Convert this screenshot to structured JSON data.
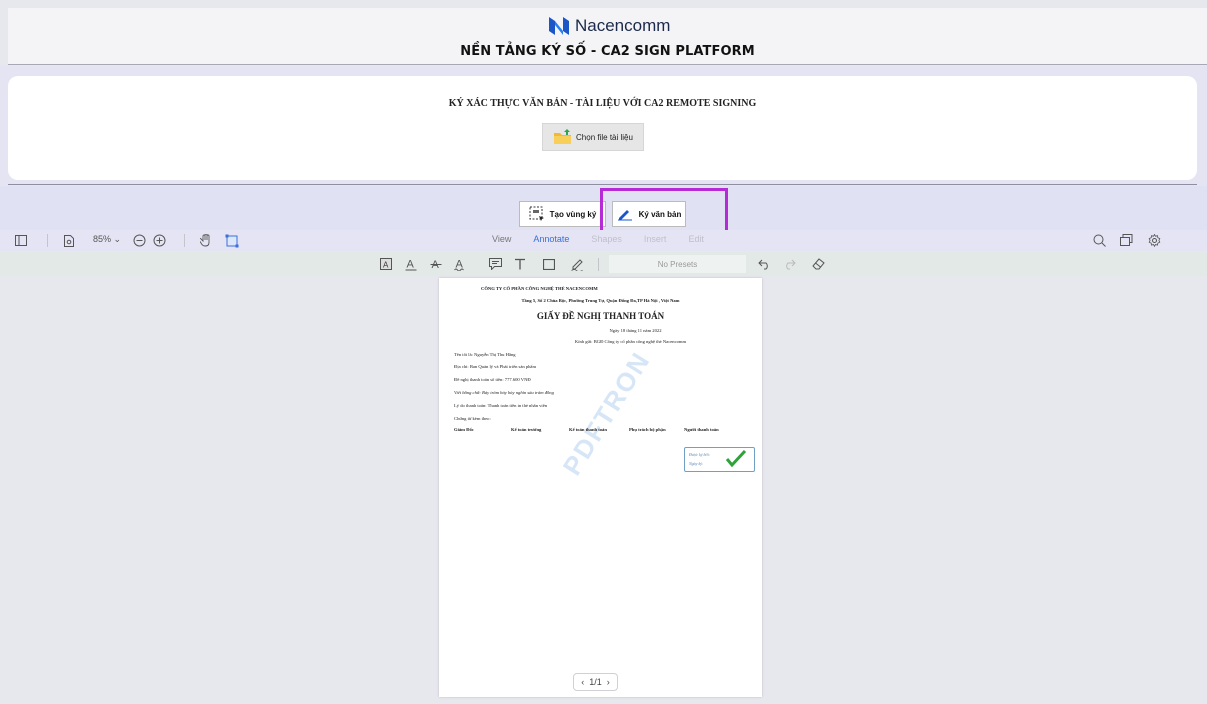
{
  "header": {
    "brand": "Nacencomm",
    "platform_title": "NỀN TẢNG KÝ SỐ - CA2 SIGN PLATFORM",
    "brand_color": "#1a56c8"
  },
  "upload": {
    "title": "KÝ XÁC THỰC VĂN BẢN - TÀI LIỆU VỚI CA2 REMOTE SIGNING",
    "choose_file_label": "Chọn file tài liệu"
  },
  "actions": {
    "create_zone_label": "Tạo vùng ký",
    "sign_label": "Ký văn bản",
    "highlight_color": "#b52bd6"
  },
  "toolbar": {
    "zoom": "85%",
    "tabs": [
      "View",
      "Annotate",
      "Shapes",
      "Insert",
      "Edit"
    ],
    "active_tab": "Annotate"
  },
  "annotate": {
    "presets_placeholder": "No Presets"
  },
  "document": {
    "company": "CÔNG TY CỔ PHẦN CÔNG NGHỆ THẺ NACENCOMM",
    "address": "Tầng 5, Số 2 Chùa Bộc, Phường Trung Tự, Quận Đống Đa,TP Hà Nội , Việt Nam",
    "title": "GIẤY ĐỀ NGHỊ THANH TOÁN",
    "date": "Ngày    18  tháng 11   năm 2022",
    "recipient": "Kính gửi: BGĐ Công ty cổ phần công nghệ thẻ Nacencomm",
    "fields": [
      "Tên tôi là: Nguyễn Thị Thu Hằng",
      "Địa chỉ: Ban Quản lý và Phát triển sản phẩm",
      "Đề nghị thanh toán số tiền:    777.600          VNĐ",
      "Viết bằng chữ: Bảy trăm bảy bảy nghìn sáu trăm đồng",
      "Lý do thanh toán: Thanh toán tiền in thẻ nhân viên",
      "Chứng từ kèm theo:"
    ],
    "signers": [
      "Giám Đốc",
      "Kế toán trưởng",
      "Kế toán thanh toán",
      "Phụ trách bộ phận",
      "Người thanh toán"
    ],
    "stamp_lines": [
      "Được ký bởi:",
      "Ngày ký:"
    ],
    "watermark": "PDFTRON",
    "page_indicator": "1/1"
  }
}
